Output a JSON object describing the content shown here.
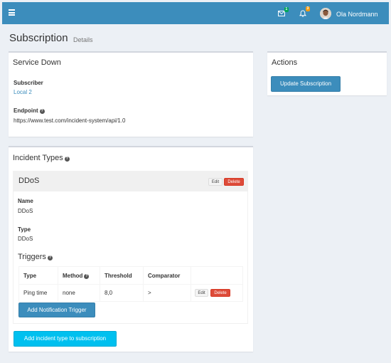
{
  "header": {
    "messages_count": "1",
    "notifications_count": "3",
    "user_name": "Ola Nordmann"
  },
  "page": {
    "title": "Subscription",
    "subtitle": "Details"
  },
  "service": {
    "title": "Service Down",
    "subscriber_label": "Subscriber",
    "subscriber_value": "Local 2",
    "endpoint_label": "Endpoint",
    "endpoint_value": "https://www.test.com/incident-system/api/1.0"
  },
  "actions": {
    "title": "Actions",
    "update_button": "Update Subscription"
  },
  "incident_types": {
    "title": "Incident Types",
    "item": {
      "heading": "DDoS",
      "edit_label": "Edit",
      "delete_label": "Delete",
      "name_label": "Name",
      "name_value": "DDoS",
      "type_label": "Type",
      "type_value": "DDoS"
    },
    "triggers": {
      "title": "Triggers",
      "headers": [
        "Type",
        "Method",
        "Threshold",
        "Comparator",
        ""
      ],
      "rows": [
        {
          "type": "Ping time",
          "method": "none",
          "threshold": "8,0",
          "comparator": ">",
          "edit": "Edit",
          "delete": "Delete"
        }
      ],
      "add_button": "Add Notification Trigger"
    },
    "add_button": "Add incident type to subscription"
  }
}
